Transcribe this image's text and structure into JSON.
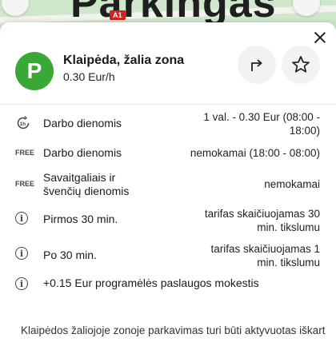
{
  "map": {
    "brand_text": "Parkingas",
    "road_badge": "A1"
  },
  "sheet": {
    "zone_badge": "P",
    "title": "Klaipėda, žalia zona",
    "subtitle": "0.30 Eur/h",
    "icons": {
      "close": "close-icon",
      "directions": "turn-right-arrow-icon",
      "favorite": "star-icon"
    }
  },
  "tariffs": [
    {
      "icon": "clock-1h-icon",
      "icon_text": "1h",
      "label": "Darbo dienomis",
      "value_line1": "1 val. - 0.30 Eur (08:00 -",
      "value_line2": "18:00)"
    },
    {
      "icon": "free-icon",
      "icon_text": "FREE",
      "label": "Darbo dienomis",
      "value_line1": "nemokamai (18:00 - 08:00)",
      "value_line2": ""
    },
    {
      "icon": "free-icon",
      "icon_text": "FREE",
      "label_line1": "Savaitgaliais ir",
      "label_line2": "švenčių dienomis",
      "value_line1": "nemokamai",
      "value_line2": ""
    },
    {
      "icon": "info-icon",
      "icon_text": "i",
      "label": "Pirmos 30 min.",
      "value_line1": "tarifas skaičiuojamas 30",
      "value_line2": "min. tikslumu"
    },
    {
      "icon": "info-icon",
      "icon_text": "i",
      "label": "Po 30 min.",
      "value_line1": "tarifas skaičiuojamas 1",
      "value_line2": "min. tikslumu"
    },
    {
      "icon": "info-icon",
      "icon_text": "i",
      "label": "+0.15 Eur programėlės paslaugos mokestis",
      "value_line1": "",
      "value_line2": ""
    }
  ],
  "footer_text": "Klaipėdos žaliojoje zonoje parkavimas turi būti aktyvuotas iškart",
  "colors": {
    "accent_green": "#3aa836",
    "text": "#1a1a1a"
  }
}
